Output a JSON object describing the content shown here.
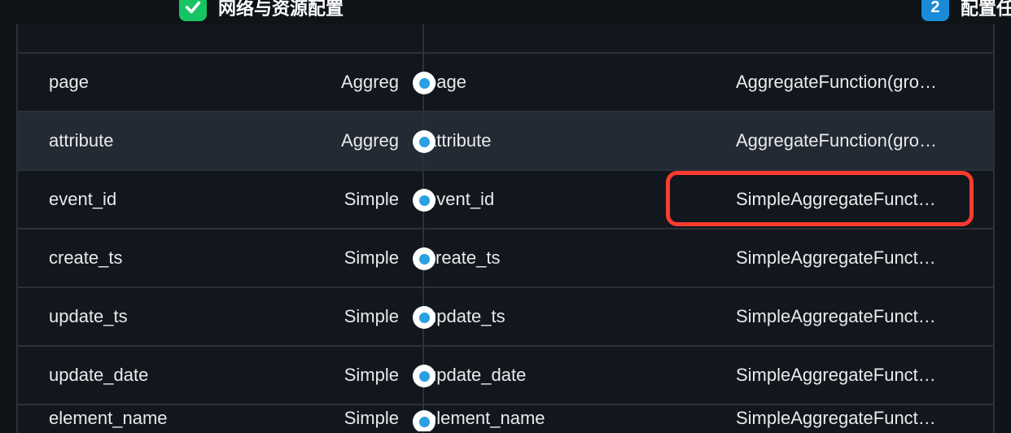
{
  "steps": {
    "done_label": "网络与资源配置",
    "pending_number": "2",
    "pending_label": "配置任"
  },
  "rows": [
    {
      "left_name": "",
      "left_type": "",
      "right_name": "",
      "right_type": "",
      "blank": true
    },
    {
      "left_name": "page",
      "left_type": "Aggreg",
      "right_name": "page",
      "right_type": "AggregateFunction(gro…"
    },
    {
      "left_name": "attribute",
      "left_type": "Aggreg",
      "right_name": "attribute",
      "right_type": "AggregateFunction(gro…",
      "hover": true
    },
    {
      "left_name": "event_id",
      "left_type": "Simple",
      "right_name": "event_id",
      "right_type": "SimpleAggregateFunct…",
      "highlight": true
    },
    {
      "left_name": "create_ts",
      "left_type": "Simple",
      "right_name": "create_ts",
      "right_type": "SimpleAggregateFunct…"
    },
    {
      "left_name": "update_ts",
      "left_type": "Simple",
      "right_name": "update_ts",
      "right_type": "SimpleAggregateFunct…"
    },
    {
      "left_name": "update_date",
      "left_type": "Simple",
      "right_name": "update_date",
      "right_type": "SimpleAggregateFunct…"
    },
    {
      "left_name": "element_name",
      "left_type": "Simple",
      "right_name": "element_name",
      "right_type": "SimpleAggregateFunct…",
      "cut": true
    }
  ]
}
